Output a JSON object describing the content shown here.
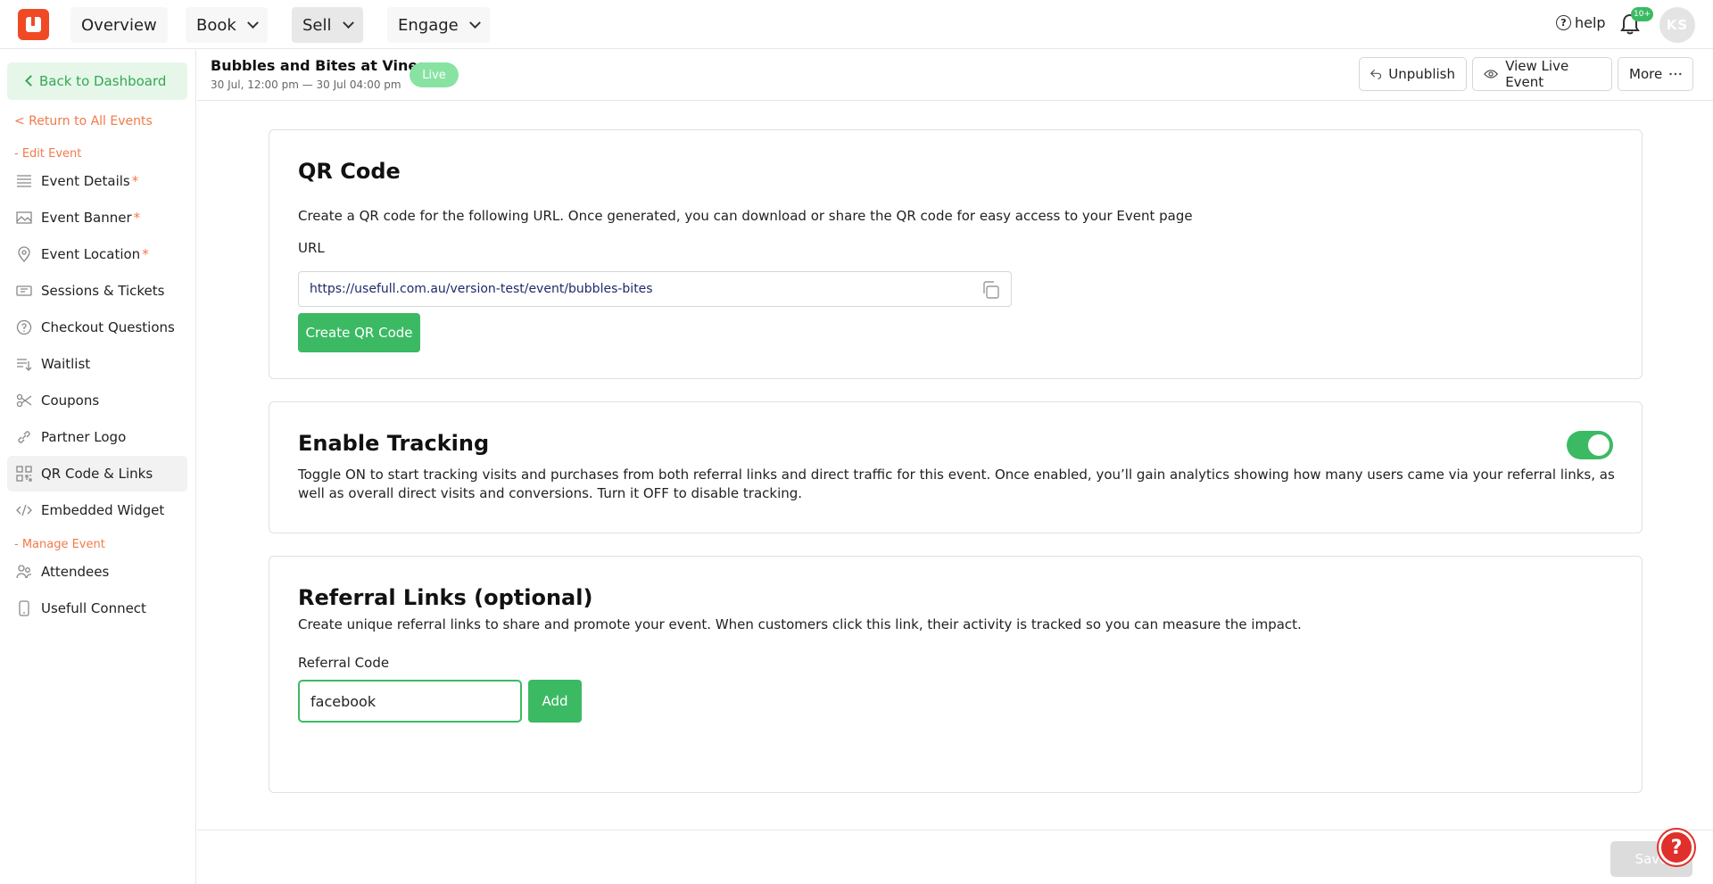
{
  "topnav": {
    "overview": "Overview",
    "book": "Book",
    "sell": "Sell",
    "engage": "Engage",
    "help": "help",
    "notification_count": "10+",
    "avatar_initials": "KS"
  },
  "sidebar": {
    "back_to_dashboard": "Back to Dashboard",
    "return_to_events": "< Return to All Events",
    "edit_event_section": "- Edit Event",
    "manage_event_section": "- Manage Event",
    "required_mark": "*",
    "items": [
      {
        "label": "Event Details",
        "icon": "list-icon",
        "required": true
      },
      {
        "label": "Event Banner",
        "icon": "image-icon",
        "required": true
      },
      {
        "label": "Event Location",
        "icon": "location-pin-icon",
        "required": true
      },
      {
        "label": "Sessions & Tickets",
        "icon": "ticket-icon",
        "required": false
      },
      {
        "label": "Checkout Questions",
        "icon": "question-circle-icon",
        "required": false
      },
      {
        "label": "Waitlist",
        "icon": "waitlist-icon",
        "required": false
      },
      {
        "label": "Coupons",
        "icon": "scissors-icon",
        "required": false
      },
      {
        "label": "Partner Logo",
        "icon": "link-icon",
        "required": false
      },
      {
        "label": "QR Code & Links",
        "icon": "qr-icon",
        "required": false
      },
      {
        "label": "Embedded Widget",
        "icon": "code-icon",
        "required": false
      }
    ],
    "manage_items": [
      {
        "label": "Attendees",
        "icon": "users-icon"
      },
      {
        "label": "Usefull Connect",
        "icon": "phone-icon"
      }
    ]
  },
  "header": {
    "event_title": "Bubbles and Bites at Vines",
    "event_date": "30 Jul, 12:00 pm — 30 Jul 04:00 pm",
    "status_badge": "Live",
    "unpublish": "Unpublish",
    "view_live": "View Live Event",
    "more": "More"
  },
  "qr_card": {
    "title": "QR Code",
    "description": "Create a QR code for the following URL. Once generated, you can download or share the QR code for easy access to your Event page",
    "url_label": "URL",
    "url_value": "https://usefull.com.au/version-test/event/bubbles-bites",
    "create_button": "Create QR Code"
  },
  "tracking_card": {
    "title": "Enable Tracking",
    "description": "Toggle ON to start tracking visits and purchases from both referral links and direct traffic for this event. Once enabled, you’ll gain analytics showing how many users came via your referral links, as well as overall direct visits and conversions. Turn it OFF to disable tracking.",
    "enabled": true
  },
  "referral_card": {
    "title": "Referral Links (optional)",
    "description": "Create unique referral links to share and promote your event. When customers click this link, their activity is tracked so you can measure the impact.",
    "code_label": "Referral Code",
    "code_value": "facebook",
    "add_button": "Add"
  },
  "footer": {
    "save": "Save",
    "help_fab": "?"
  },
  "colors": {
    "brand": "#f04a24",
    "green": "#3cba63",
    "accent_orange": "#f07a4a"
  }
}
